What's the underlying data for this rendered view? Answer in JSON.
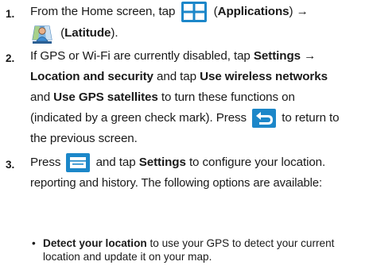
{
  "steps": [
    {
      "number": "1.",
      "line1_pre": "From the Home screen, tap",
      "line1_icon": "applications-grid-icon",
      "line1_paren_open": "(",
      "line1_bold": "Applications",
      "line1_paren_close": ")",
      "line1_arrow": "→",
      "line2_icon": "latitude-app-icon",
      "line2_paren_open": "(",
      "line2_bold": "Latitude",
      "line2_paren_close": ")."
    },
    {
      "number": "2.",
      "line1_pre": "If GPS or Wi-Fi are currently disabled, tap",
      "line1_bold": "Settings",
      "line1_arrow": "→",
      "line2_bold": "Location and security",
      "line2_mid": "and tap",
      "line2_bold2": "Use wireless networks",
      "line3_pre": "and",
      "line3_bold": "Use GPS satellites",
      "line3_post": "to turn these functions on",
      "line4_pre": "(indicated by a green check mark). Press",
      "line4_icon": "back-arrow-icon",
      "line4_post": "to return to",
      "line5": "the previous screen."
    },
    {
      "number": "3.",
      "line1_pre": "Press",
      "line1_icon": "menu-key-icon",
      "line1_mid": "and tap",
      "line1_bold": "Settings",
      "line1_post": "to configure your location.",
      "line2": "reporting and history. The following options are available:"
    }
  ],
  "bullets": [
    {
      "bold": "Detect your location",
      "text1": "to use your GPS to detect your current",
      "text2": "location and update it on your map."
    }
  ],
  "colors": {
    "icon_blue": "#1c87c9",
    "icon_dark": "#2b2b2b"
  }
}
